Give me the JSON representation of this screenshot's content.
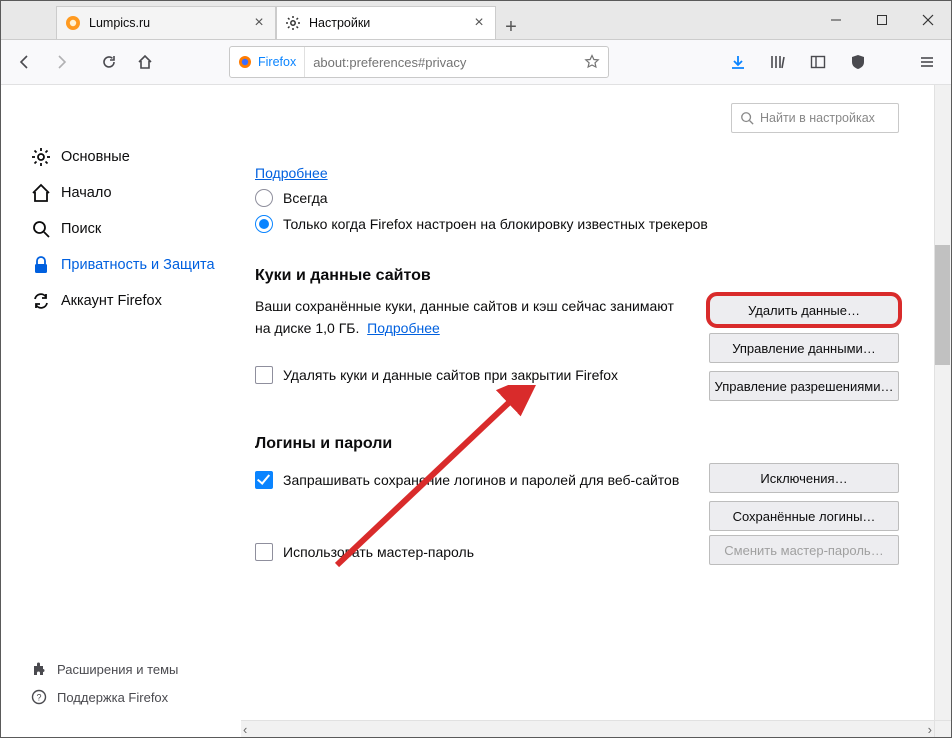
{
  "window": {
    "tabs": [
      {
        "label": "Lumpics.ru"
      },
      {
        "label": "Настройки"
      }
    ]
  },
  "urlbar": {
    "identity_label": "Firefox",
    "url": "about:preferences#privacy"
  },
  "search": {
    "placeholder": "Найти в настройках"
  },
  "sidebar": {
    "items": [
      {
        "label": "Основные"
      },
      {
        "label": "Начало"
      },
      {
        "label": "Поиск"
      },
      {
        "label": "Приватность и Защита"
      },
      {
        "label": "Аккаунт Firefox"
      }
    ],
    "footer": [
      {
        "label": "Расширения и темы"
      },
      {
        "label": "Поддержка Firefox"
      }
    ]
  },
  "content": {
    "more_link": "Подробнее",
    "radio_always": "Всегда",
    "radio_trackers": "Только когда Firefox настроен на блокировку известных трекеров",
    "cookies": {
      "title": "Куки и данные сайтов",
      "desc_prefix": "Ваши сохранённые куки, данные сайтов и кэш сейчас занимают на диске ",
      "size": "1,0 ГБ.",
      "desc_more": "Подробнее",
      "delete_on_close": "Удалять куки и данные сайтов при закрытии Firefox",
      "buttons": {
        "clear": "Удалить данные…",
        "manage": "Управление данными…",
        "permissions": "Управление разрешениями…"
      }
    },
    "logins": {
      "title": "Логины и пароли",
      "ask_save": "Запрашивать сохранение логинов и паролей для веб-сайтов",
      "use_master": "Использовать мастер-пароль",
      "buttons": {
        "exceptions": "Исключения…",
        "saved": "Сохранённые логины…",
        "change_master": "Сменить мастер-пароль…"
      }
    }
  }
}
